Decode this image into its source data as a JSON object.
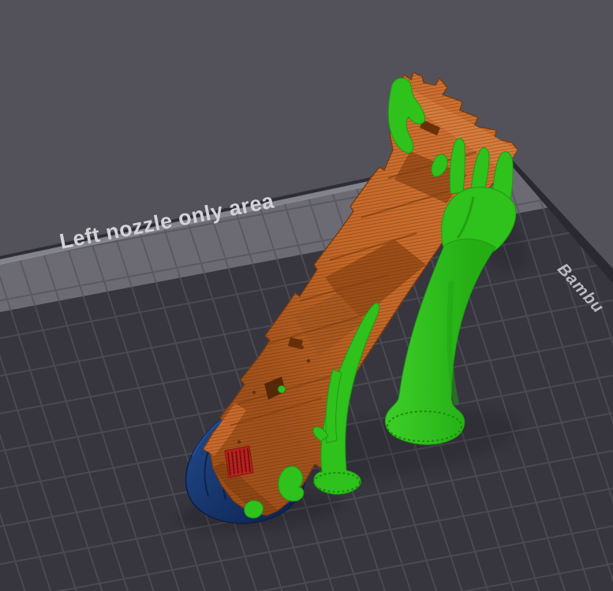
{
  "viewport": {
    "plate": {
      "strip_label": "Left nozzle only area",
      "brand_label": "Bambu"
    }
  },
  "scene": {
    "objects": [
      {
        "name": "sliced-model",
        "color": "#C06325"
      },
      {
        "name": "tree-supports",
        "color": "#2FC11C"
      },
      {
        "name": "support-skirt",
        "color": "#16356B"
      },
      {
        "name": "vent-detail",
        "color": "#C32121"
      }
    ]
  },
  "theme": {
    "bg": "#53525A",
    "plate": "#37363F",
    "plate-line": "#4A4953",
    "strip": "#6C6B74",
    "strip-line": "#5A5962",
    "strip-text": "#D3D3D8",
    "edge-wall": "#2A2932",
    "rim-light": "#8C8C94",
    "rim-dark": "#2E2D35",
    "brand-text": "#B9B9C1",
    "orange": "#C06325",
    "orange-light": "#D97F40",
    "orange-mid": "#A85A1F",
    "orange-dark": "#8E4614",
    "orange-outline": "#7A3A0E",
    "green": "#2FC11C",
    "green-dark": "#1E9B12",
    "navy": "#16356B",
    "navy-dark": "#0B1F44",
    "navy-light": "#2A55A0",
    "red": "#C32121",
    "red-dark": "#7A0F0F"
  }
}
